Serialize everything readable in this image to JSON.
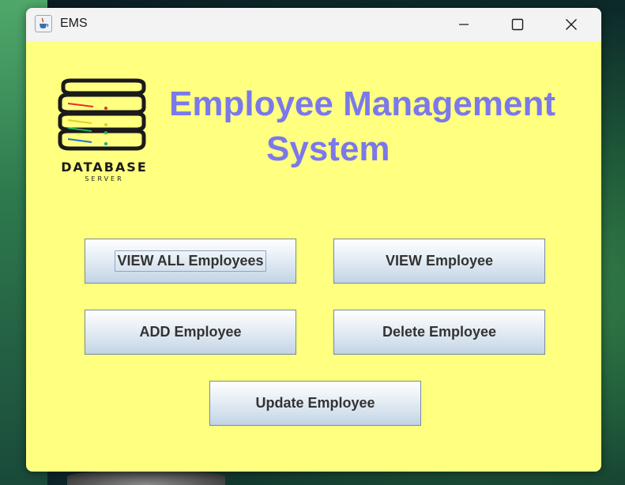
{
  "window": {
    "title": "EMS",
    "app_icon": "java-cup-icon",
    "controls": [
      "minimize-icon",
      "maximize-icon",
      "close-icon"
    ]
  },
  "logo": {
    "icon": "database-stack-icon",
    "text": "DATABASE",
    "subtext": "SERVER"
  },
  "heading": {
    "line1": "Employee Management",
    "line2": "System",
    "color": "#7b79ea"
  },
  "buttons": {
    "view_all": "VIEW ALL Employees",
    "view": "VIEW Employee",
    "add": "ADD Employee",
    "delete": "Delete Employee",
    "update": "Update Employee"
  },
  "colors": {
    "window_background": "#ffff80",
    "titlebar_background": "#f3f3f3"
  }
}
